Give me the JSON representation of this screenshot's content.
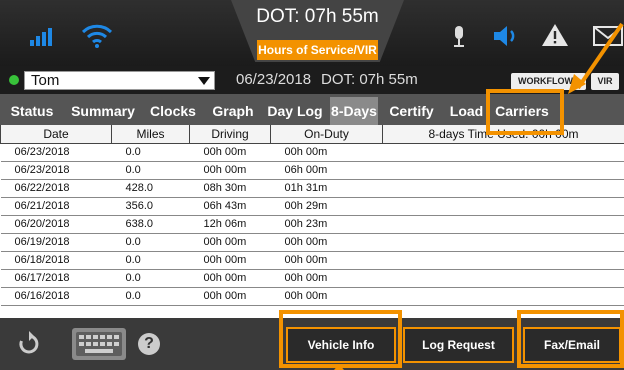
{
  "header": {
    "dot_time": "DOT: 07h 55m",
    "hos_label": "Hours of Service/VIR",
    "icons": [
      "signal-icon",
      "wifi-icon",
      "microphone-icon",
      "speaker-icon",
      "warning-icon",
      "mail-icon"
    ]
  },
  "driver": {
    "name": "Tom",
    "date": "06/23/2018",
    "dot_time": "DOT: 07h 55m",
    "workflow_label": "WORKFLOW",
    "vir_label": "VIR"
  },
  "tabs": [
    {
      "label": "Status"
    },
    {
      "label": "Summary"
    },
    {
      "label": "Clocks"
    },
    {
      "label": "Graph"
    },
    {
      "label": "Day Log"
    },
    {
      "label": "8-Days"
    },
    {
      "label": "Certify"
    },
    {
      "label": "Load"
    },
    {
      "label": "Carriers"
    }
  ],
  "active_tab": "8-Days",
  "table": {
    "columns": [
      "Date",
      "Miles",
      "Driving",
      "On-Duty",
      "8-days Time Used: 00h 00m"
    ],
    "rows": [
      [
        "06/23/2018",
        "0.0",
        "00h 00m",
        "00h 00m"
      ],
      [
        "06/23/2018",
        "0.0",
        "00h 00m",
        "06h 00m"
      ],
      [
        "06/22/2018",
        "428.0",
        "08h 30m",
        "01h 31m"
      ],
      [
        "06/21/2018",
        "356.0",
        "06h 43m",
        "00h 29m"
      ],
      [
        "06/20/2018",
        "638.0",
        "12h 06m",
        "00h 23m"
      ],
      [
        "06/19/2018",
        "0.0",
        "00h 00m",
        "00h 00m"
      ],
      [
        "06/18/2018",
        "0.0",
        "00h 00m",
        "00h 00m"
      ],
      [
        "06/17/2018",
        "0.0",
        "00h 00m",
        "00h 00m"
      ],
      [
        "06/16/2018",
        "0.0",
        "00h 00m",
        "00h 00m"
      ]
    ]
  },
  "footer": {
    "vehicle_info": "Vehicle Info",
    "log_request": "Log Request",
    "fax_email": "Fax/Email",
    "help_glyph": "?"
  },
  "colors": {
    "accent": "#f39200",
    "signal_blue": "#1e88e5",
    "status_green": "#38c23a"
  }
}
